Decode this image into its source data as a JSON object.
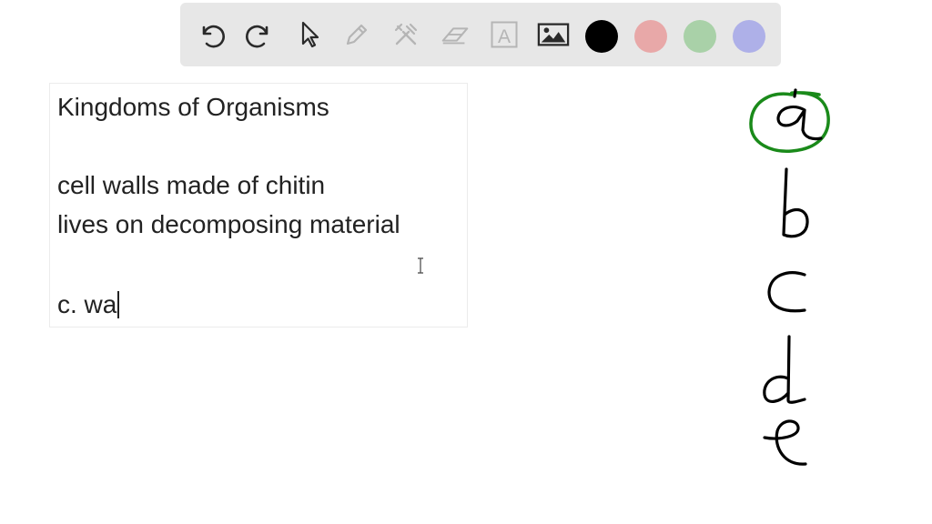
{
  "toolbar": {
    "tools": [
      {
        "name": "undo-icon"
      },
      {
        "name": "redo-icon"
      },
      {
        "name": "pointer-icon"
      },
      {
        "name": "pen-icon"
      },
      {
        "name": "tools-icon"
      },
      {
        "name": "eraser-icon"
      },
      {
        "name": "text-icon",
        "glyph": "A"
      },
      {
        "name": "image-icon"
      }
    ],
    "colors": [
      {
        "name": "black",
        "hex": "#000000",
        "selected": true
      },
      {
        "name": "red",
        "hex": "#e8a8a8"
      },
      {
        "name": "green",
        "hex": "#a9d1a8"
      },
      {
        "name": "blue",
        "hex": "#aeb0e8"
      }
    ],
    "icon_color": "#2a2a2a",
    "disabled_icon_color": "#b5b5b5"
  },
  "textbox": {
    "lines": [
      "Kingdoms of Organisms",
      "",
      "cell walls made of chitin",
      "lives on decomposing material",
      "",
      "c. wa"
    ]
  },
  "handwriting": {
    "letters": [
      "a",
      "b",
      "c",
      "d",
      "e"
    ],
    "ink_color": "#000000",
    "highlight_color": "#1a8a1a",
    "circled_letter": "a"
  }
}
